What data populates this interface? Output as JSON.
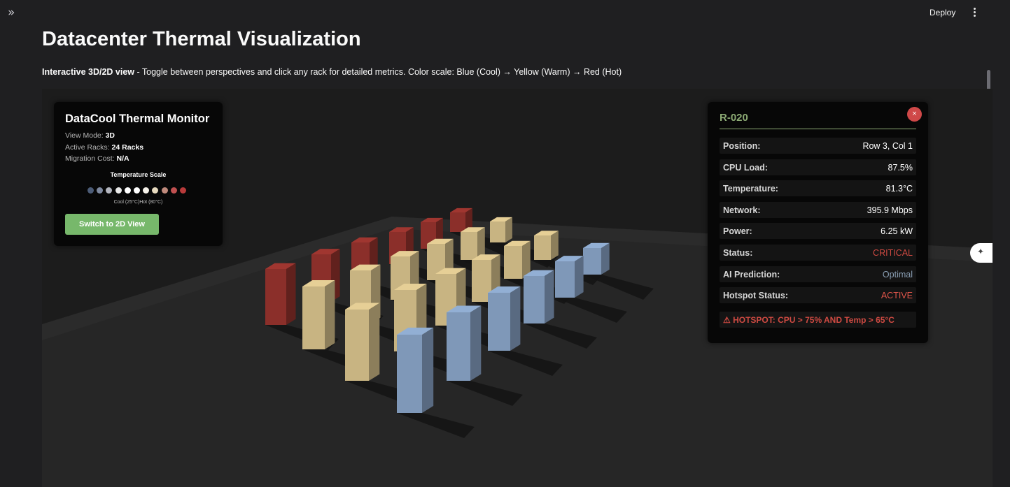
{
  "app": {
    "deploy_label": "Deploy",
    "title": "Datacenter Thermal Visualization",
    "subtitle_bold": "Interactive 3D/2D view",
    "subtitle_rest": " - Toggle between perspectives and click any rack for detailed metrics. Color scale: Blue (Cool) → Yellow (Warm) → Red (Hot)"
  },
  "monitor": {
    "title": "DataCool Thermal Monitor",
    "view_mode_label": "View Mode:",
    "view_mode_value": "3D",
    "active_racks_label": "Active Racks:",
    "active_racks_value": "24 Racks",
    "migration_cost_label": "Migration Cost:",
    "migration_cost_value": "N/A",
    "scale_title": "Temperature Scale",
    "scale_legend": "Cool (25°C)Hot (80°C)",
    "scale_colors": [
      "#4c5c77",
      "#7f8aa0",
      "#b3b6bf",
      "#e8e8e8",
      "#ffffff",
      "#ffffff",
      "#f6f2ea",
      "#e6d9be",
      "#c08a7c",
      "#c05050",
      "#b83a3a"
    ],
    "switch_label": "Switch to 2D View"
  },
  "detail": {
    "rack_id": "R-020",
    "close_label": "×",
    "rows": [
      {
        "label": "Position:",
        "value": "Row 3, Col 1",
        "color": "#ffffff"
      },
      {
        "label": "CPU Load:",
        "value": "87.5%",
        "color": "#ffffff"
      },
      {
        "label": "Temperature:",
        "value": "81.3°C",
        "color": "#ffffff"
      },
      {
        "label": "Network:",
        "value": "395.9 Mbps",
        "color": "#ffffff"
      },
      {
        "label": "Power:",
        "value": "6.25 kW",
        "color": "#ffffff"
      },
      {
        "label": "Status:",
        "value": "CRITICAL",
        "color": "#cf4a42"
      },
      {
        "label": "AI Prediction:",
        "value": "Optimal",
        "color": "#8a9fb4"
      },
      {
        "label": "Hotspot Status:",
        "value": "ACTIVE",
        "color": "#e0554a"
      }
    ],
    "hotspot_message": "⚠ HOTSPOT: CPU > 75% AND Temp > 65°C"
  },
  "colors": {
    "hot": "#8b2f2a",
    "warm": "#c8b482",
    "cool": "#7f98b8",
    "accent": "#77b86b",
    "rack_title": "#8caa74"
  }
}
